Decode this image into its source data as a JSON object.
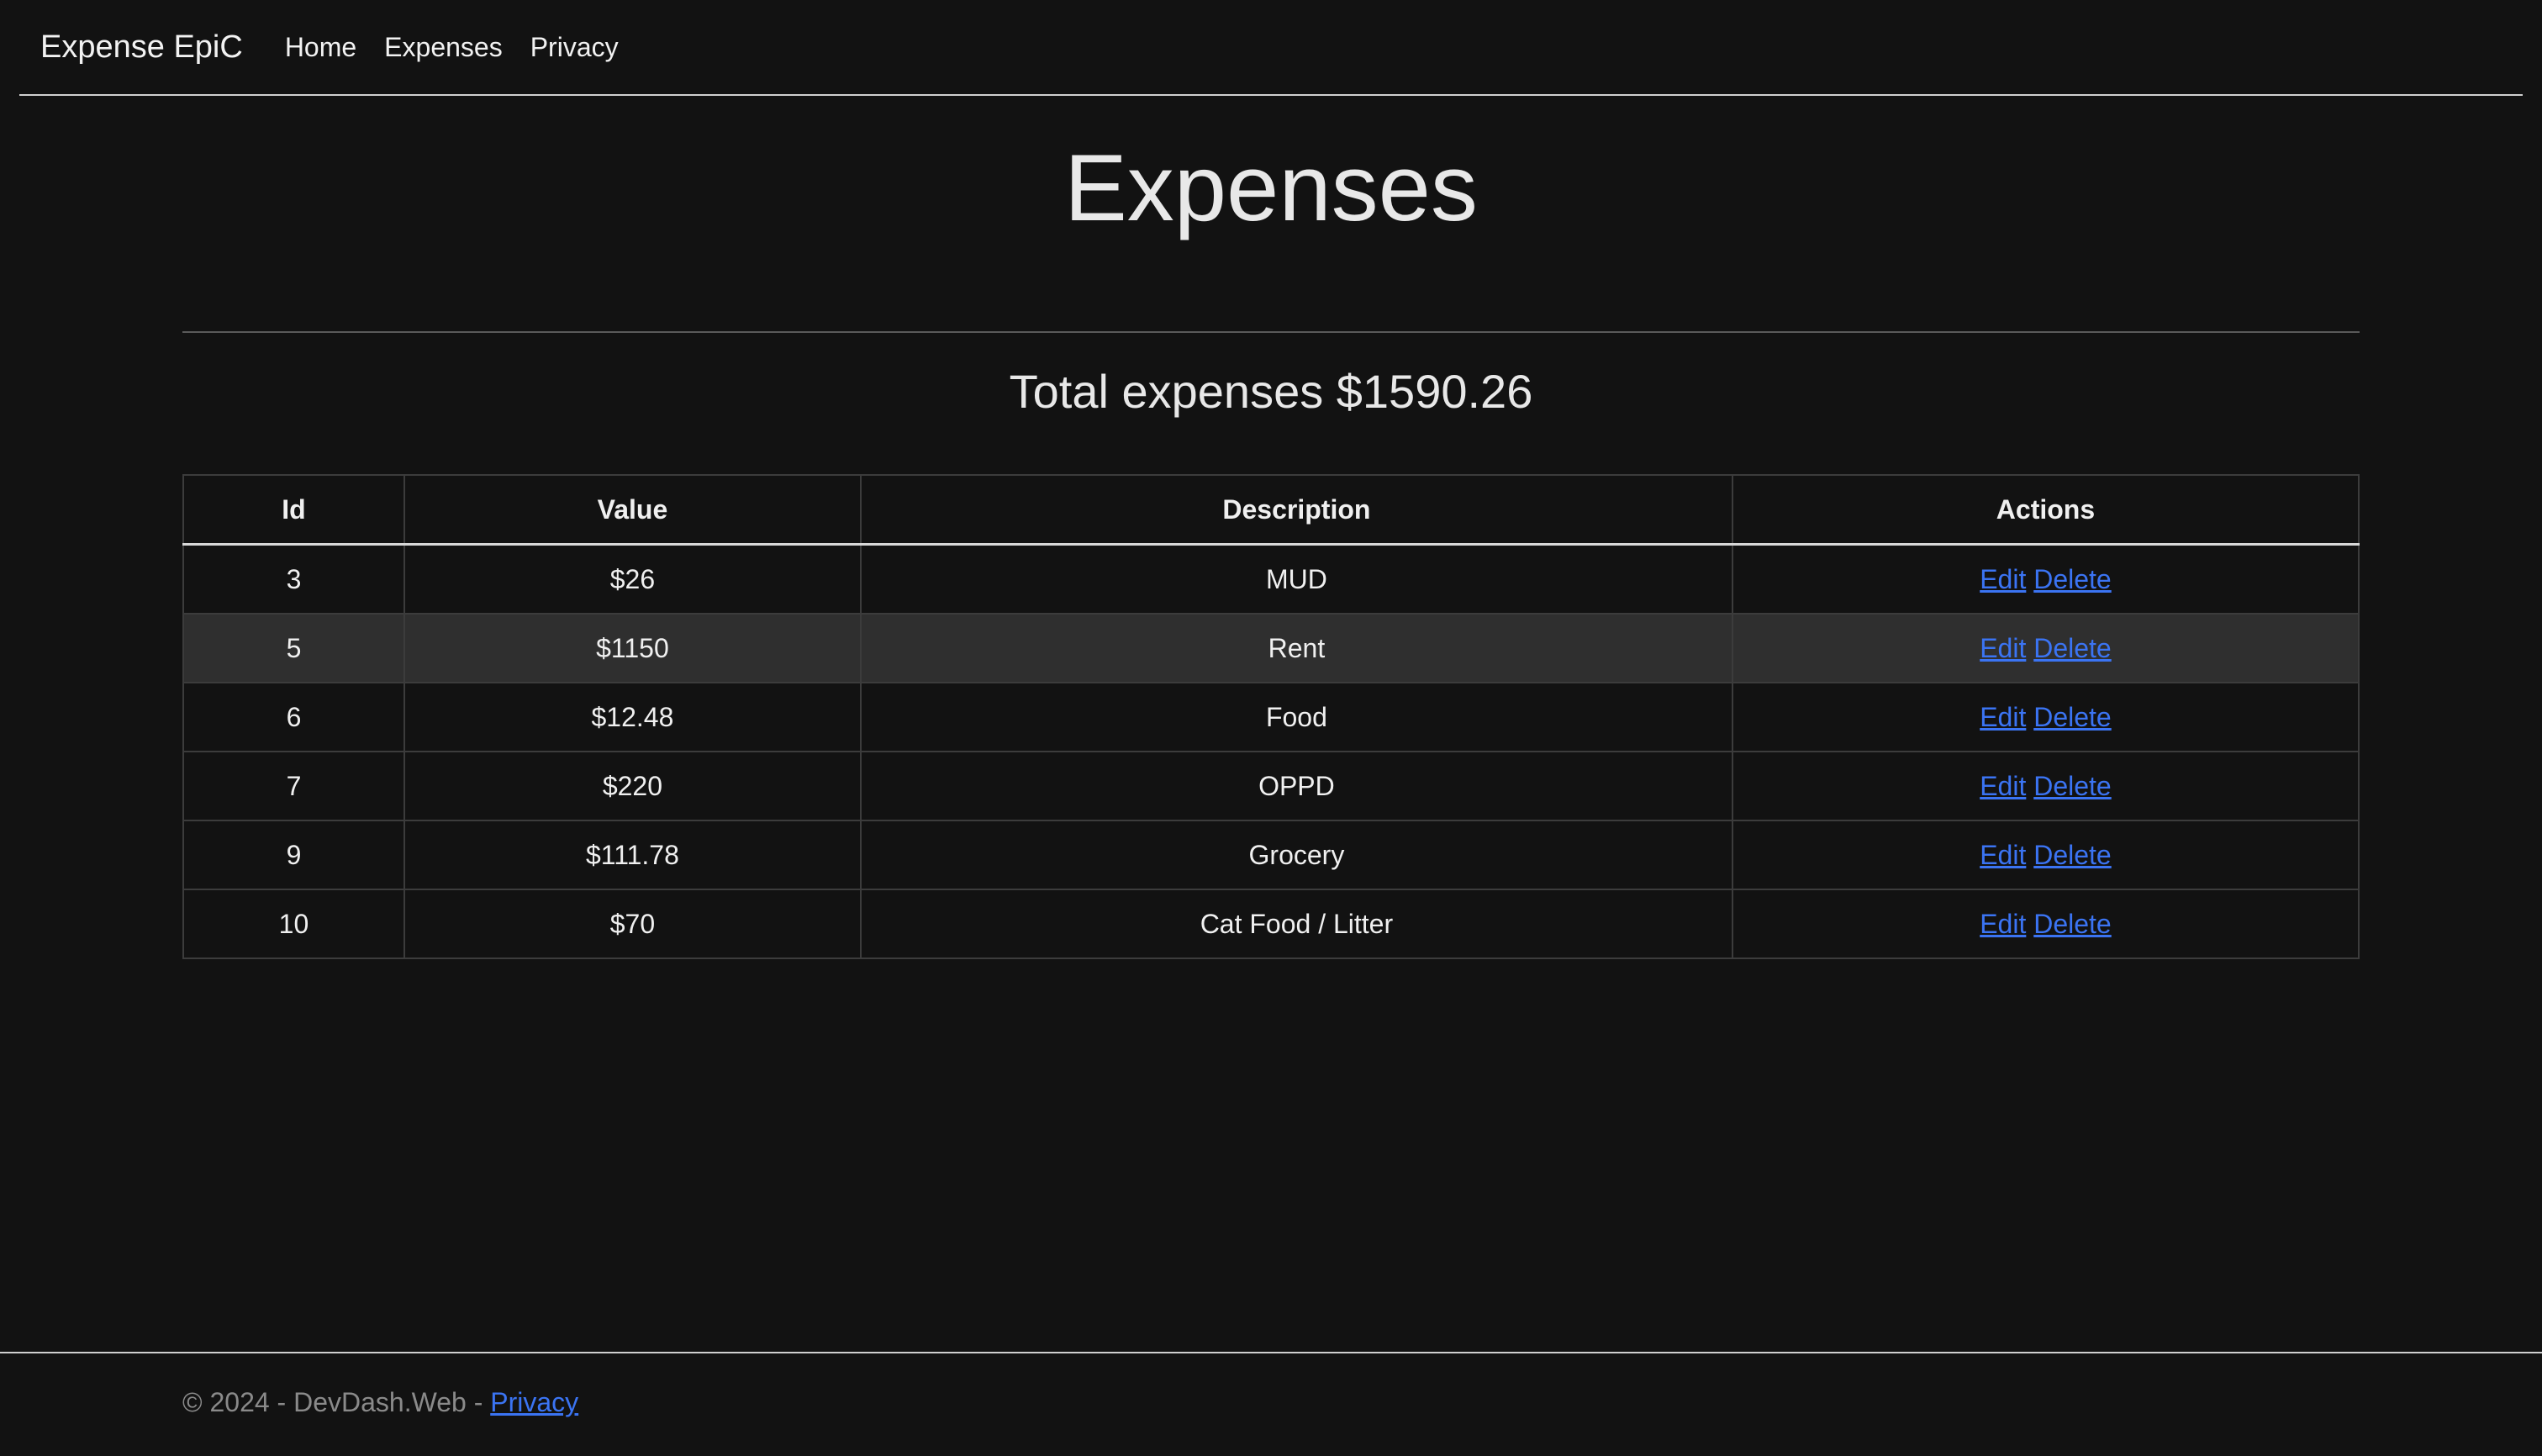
{
  "navbar": {
    "brand": "Expense EpiC",
    "links": [
      "Home",
      "Expenses",
      "Privacy"
    ]
  },
  "page": {
    "title": "Expenses",
    "total_label": "Total expenses $1590.26"
  },
  "table": {
    "headers": [
      "Id",
      "Value",
      "Description",
      "Actions"
    ],
    "rows": [
      {
        "id": "3",
        "value": "$26",
        "description": "MUD",
        "edit": "Edit",
        "delete": "Delete"
      },
      {
        "id": "5",
        "value": "$1150",
        "description": "Rent",
        "edit": "Edit",
        "delete": "Delete"
      },
      {
        "id": "6",
        "value": "$12.48",
        "description": "Food",
        "edit": "Edit",
        "delete": "Delete"
      },
      {
        "id": "7",
        "value": "$220",
        "description": "OPPD",
        "edit": "Edit",
        "delete": "Delete"
      },
      {
        "id": "9",
        "value": "$111.78",
        "description": "Grocery",
        "edit": "Edit",
        "delete": "Delete"
      },
      {
        "id": "10",
        "value": "$70",
        "description": "Cat Food / Litter",
        "edit": "Edit",
        "delete": "Delete"
      }
    ]
  },
  "footer": {
    "text": "© 2024 - DevDash.Web - ",
    "privacy_link": "Privacy"
  },
  "colors": {
    "background": "#121212",
    "link": "#3b74f3",
    "highlight_row": "#2f2f2f"
  }
}
